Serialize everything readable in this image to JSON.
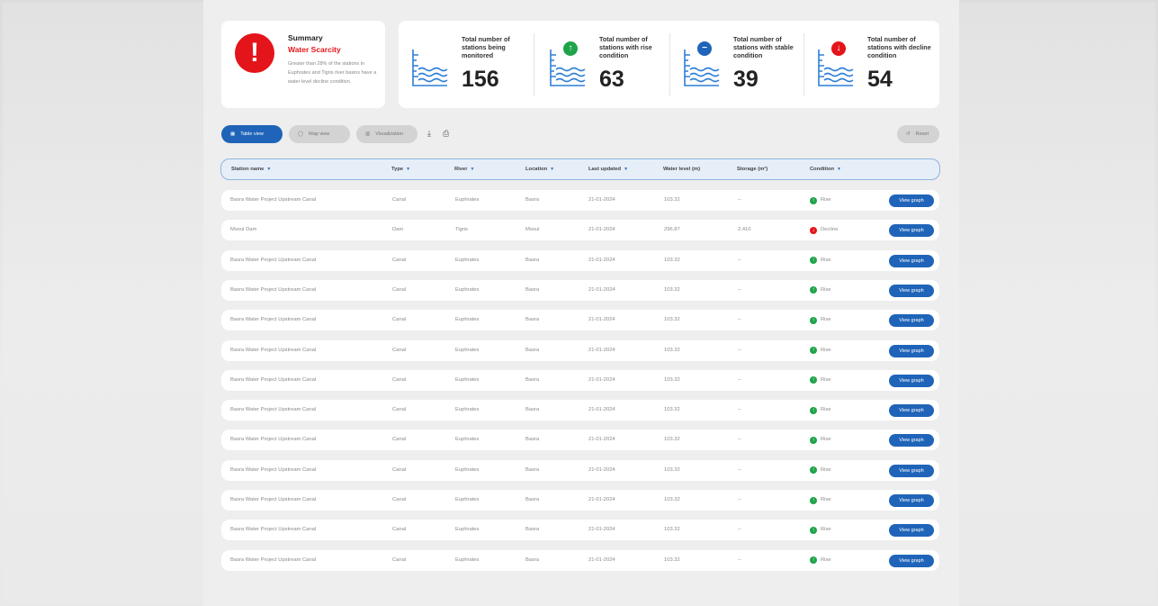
{
  "summary": {
    "title": "Summary",
    "subtitle": "Water Scarcity",
    "description": "Greater than 28% of the stations in Euphrates and Tigris river basins have a water level decline condition.",
    "alert_glyph": "!"
  },
  "stats": [
    {
      "label": "Total number of stations being monitored",
      "value": "156",
      "badge": "",
      "badge_color": ""
    },
    {
      "label": "Total number of stations with rise condition",
      "value": "63",
      "badge": "↑",
      "badge_color": "#1fa34a"
    },
    {
      "label": "Total number of stations with stable condition",
      "value": "39",
      "badge": "−",
      "badge_color": "#1f64b8"
    },
    {
      "label": "Total number of stations with decline condition",
      "value": "54",
      "badge": "↓",
      "badge_color": "#e4141b"
    }
  ],
  "toolbar": {
    "table_view": "Table view",
    "map_view": "Map view",
    "visualization": "Visualization",
    "reset": "Reset",
    "download_icon": "⤓",
    "print_icon": "⎙"
  },
  "columns": [
    "Station name",
    "Type",
    "River",
    "Location",
    "Last updated",
    "Water level (m)",
    "Storage (m³)",
    "Condition"
  ],
  "rows": [
    {
      "name": "Basra Water Project Upstream Canal",
      "type": "Canal",
      "river": "Euphrates",
      "location": "Basra",
      "updated": "21-01-2024",
      "level": "103.32",
      "storage": "--",
      "condition": "Rise",
      "cond_color": "#1fa34a",
      "cond_glyph": "↑"
    },
    {
      "name": "Mosul Dam",
      "type": "Dam",
      "river": "Tigris",
      "location": "Mosul",
      "updated": "21-01-2024",
      "level": "296.87",
      "storage": "2,410",
      "condition": "Decline",
      "cond_color": "#e4141b",
      "cond_glyph": "↓"
    },
    {
      "name": "Basra Water Project Upstream Canal",
      "type": "Canal",
      "river": "Euphrates",
      "location": "Basra",
      "updated": "21-01-2024",
      "level": "103.32",
      "storage": "--",
      "condition": "Rise",
      "cond_color": "#1fa34a",
      "cond_glyph": "↑"
    },
    {
      "name": "Basra Water Project Upstream Canal",
      "type": "Canal",
      "river": "Euphrates",
      "location": "Basra",
      "updated": "21-01-2024",
      "level": "103.32",
      "storage": "--",
      "condition": "Rise",
      "cond_color": "#1fa34a",
      "cond_glyph": "↑"
    },
    {
      "name": "Basra Water Project Upstream Canal",
      "type": "Canal",
      "river": "Euphrates",
      "location": "Basra",
      "updated": "21-01-2024",
      "level": "103.32",
      "storage": "--",
      "condition": "Rise",
      "cond_color": "#1fa34a",
      "cond_glyph": "↑"
    },
    {
      "name": "Basra Water Project Upstream Canal",
      "type": "Canal",
      "river": "Euphrates",
      "location": "Basra",
      "updated": "21-01-2024",
      "level": "103.32",
      "storage": "--",
      "condition": "Rise",
      "cond_color": "#1fa34a",
      "cond_glyph": "↑"
    },
    {
      "name": "Basra Water Project Upstream Canal",
      "type": "Canal",
      "river": "Euphrates",
      "location": "Basra",
      "updated": "21-01-2024",
      "level": "103.32",
      "storage": "--",
      "condition": "Rise",
      "cond_color": "#1fa34a",
      "cond_glyph": "↑"
    },
    {
      "name": "Basra Water Project Upstream Canal",
      "type": "Canal",
      "river": "Euphrates",
      "location": "Basra",
      "updated": "21-01-2024",
      "level": "103.32",
      "storage": "--",
      "condition": "Rise",
      "cond_color": "#1fa34a",
      "cond_glyph": "↑"
    },
    {
      "name": "Basra Water Project Upstream Canal",
      "type": "Canal",
      "river": "Euphrates",
      "location": "Basra",
      "updated": "21-01-2024",
      "level": "103.32",
      "storage": "--",
      "condition": "Rise",
      "cond_color": "#1fa34a",
      "cond_glyph": "↑"
    },
    {
      "name": "Basra Water Project Upstream Canal",
      "type": "Canal",
      "river": "Euphrates",
      "location": "Basra",
      "updated": "21-01-2024",
      "level": "103.32",
      "storage": "--",
      "condition": "Rise",
      "cond_color": "#1fa34a",
      "cond_glyph": "↑"
    },
    {
      "name": "Basra Water Project Upstream Canal",
      "type": "Canal",
      "river": "Euphrates",
      "location": "Basra",
      "updated": "21-01-2024",
      "level": "103.32",
      "storage": "--",
      "condition": "Rise",
      "cond_color": "#1fa34a",
      "cond_glyph": "↑"
    },
    {
      "name": "Basra Water Project Upstream Canal",
      "type": "Canal",
      "river": "Euphrates",
      "location": "Basra",
      "updated": "21-01-2024",
      "level": "103.32",
      "storage": "--",
      "condition": "Rise",
      "cond_color": "#1fa34a",
      "cond_glyph": "↑"
    },
    {
      "name": "Basra Water Project Upstream Canal",
      "type": "Canal",
      "river": "Euphrates",
      "location": "Basra",
      "updated": "21-01-2024",
      "level": "103.32",
      "storage": "--",
      "condition": "Rise",
      "cond_color": "#1fa34a",
      "cond_glyph": "↑"
    }
  ],
  "row_action": "View graph",
  "colors": {
    "accent": "#1f64b8",
    "alert": "#e4141b",
    "rise": "#1fa34a",
    "gauge": "#2f7fd6"
  }
}
